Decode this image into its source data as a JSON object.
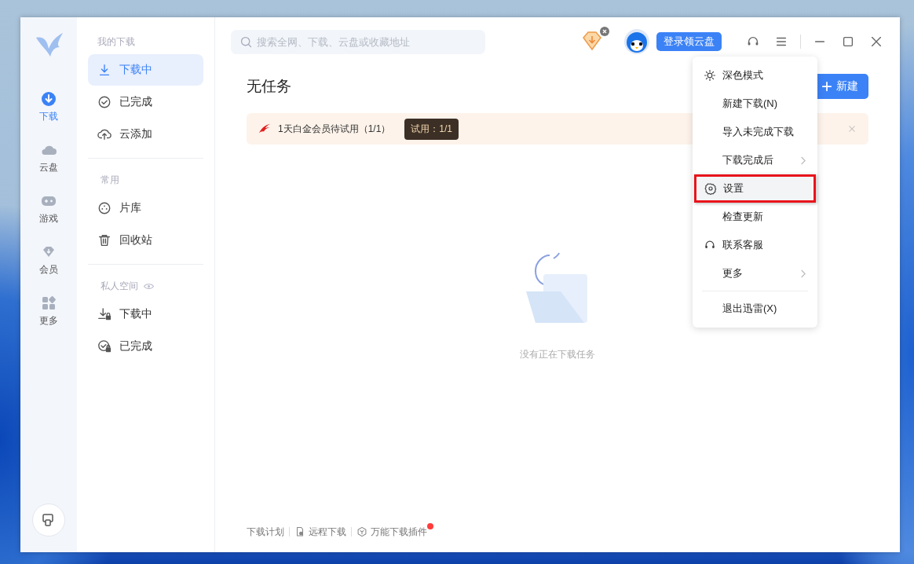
{
  "rail": {
    "items": [
      {
        "label": "下载",
        "selected": true
      },
      {
        "label": "云盘",
        "selected": false
      },
      {
        "label": "游戏",
        "selected": false
      },
      {
        "label": "会员",
        "selected": false
      },
      {
        "label": "更多",
        "selected": false
      }
    ]
  },
  "sidebar": {
    "sections": [
      {
        "title": "我的下载",
        "items": [
          {
            "label": "下载中",
            "selected": true
          },
          {
            "label": "已完成",
            "selected": false
          },
          {
            "label": "云添加",
            "selected": false
          }
        ]
      },
      {
        "title": "常用",
        "items": [
          {
            "label": "片库",
            "selected": false
          },
          {
            "label": "回收站",
            "selected": false
          }
        ]
      },
      {
        "title": "私人空间",
        "items": [
          {
            "label": "下载中",
            "selected": false
          },
          {
            "label": "已完成",
            "selected": false
          }
        ]
      }
    ]
  },
  "search": {
    "placeholder": "搜索全网、下载、云盘或收藏地址"
  },
  "login_button": "登录领云盘",
  "title": "无任务",
  "new_button": "新建",
  "banner": {
    "text": "1天白金会员待试用（1/1）",
    "badge": "试用：1/1"
  },
  "empty_text": "没有正在下载任务",
  "footer": [
    {
      "label": "下载计划",
      "badge": false
    },
    {
      "label": "远程下载",
      "badge": false
    },
    {
      "label": "万能下载插件",
      "badge": true
    }
  ],
  "menu": {
    "groups": [
      [
        {
          "label": "深色模式",
          "submenu": false,
          "selected": false
        },
        {
          "label": "新建下载(N)",
          "submenu": false,
          "selected": false
        },
        {
          "label": "导入未完成下载",
          "submenu": false,
          "selected": false
        },
        {
          "label": "下载完成后",
          "submenu": true,
          "selected": false
        },
        {
          "label": "设置",
          "submenu": false,
          "selected": true
        },
        {
          "label": "检查更新",
          "submenu": false,
          "selected": false
        },
        {
          "label": "联系客服",
          "submenu": false,
          "selected": false
        },
        {
          "label": "更多",
          "submenu": true,
          "selected": false
        }
      ],
      [
        {
          "label": "退出迅雷(X)",
          "submenu": false,
          "selected": false
        }
      ]
    ]
  }
}
